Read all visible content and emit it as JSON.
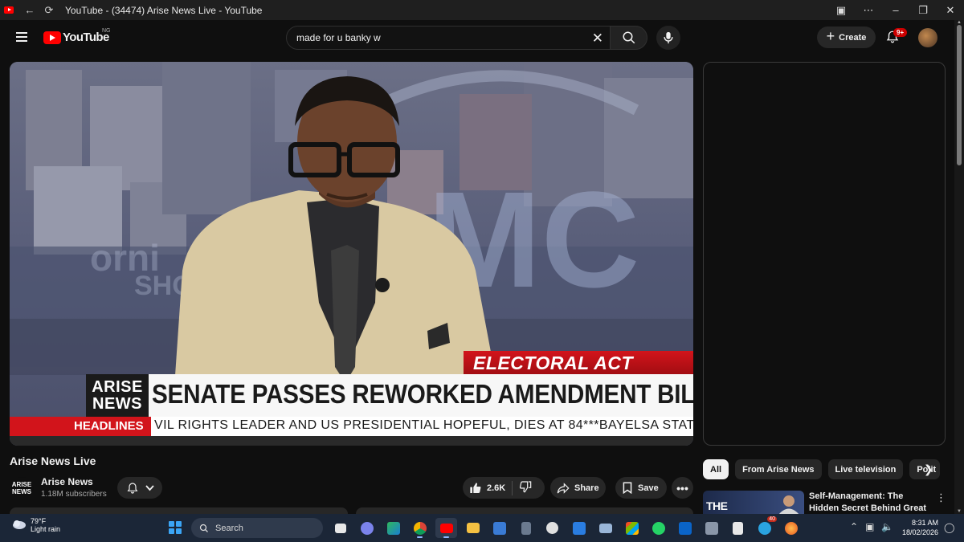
{
  "browser": {
    "tab_title": "YouTube - (34474) Arise News Live - YouTube"
  },
  "masthead": {
    "logo_text": "YouTube",
    "country_code": "NG",
    "search_value": "made for u banky w",
    "create_label": "Create",
    "notification_count": "9+"
  },
  "player": {
    "lower_third_tag": "ELECTORAL ACT",
    "headline": "SENATE PASSES REWORKED AMENDMENT BILL",
    "brand_line1": "ARISE",
    "brand_line2": "NEWS",
    "ticker_label": "HEADLINES",
    "ticker_text": "VIL RIGHTS LEADER AND US PRESIDENTIAL HOPEFUL, DIES AT 84***BAYELSA STATE GO"
  },
  "video": {
    "title": "Arise News Live",
    "channel_name": "Arise News",
    "channel_avatar_line1": "ARISE",
    "channel_avatar_line2": "NEWS",
    "subscribers": "1.18M subscribers",
    "likes": "2.6K",
    "share_label": "Share",
    "save_label": "Save"
  },
  "sidebar": {
    "chips": [
      "All",
      "From Arise News",
      "Live television",
      "Polit"
    ],
    "recommendation": {
      "thumb_text": "THE",
      "title": "Self-Management: The Hidden Secret Behind Great Leadershi..."
    }
  },
  "taskbar": {
    "weather_temp": "79°F",
    "weather_desc": "Light rain",
    "search_label": "Search",
    "time": "8:31 AM",
    "date": "18/02/2026",
    "telegram_badge": "40"
  },
  "colors": {
    "yt_red": "#ff0000",
    "bg": "#0f0f0f",
    "pill": "#272727",
    "news_red": "#d2141b",
    "taskbar": "#1b2637"
  }
}
